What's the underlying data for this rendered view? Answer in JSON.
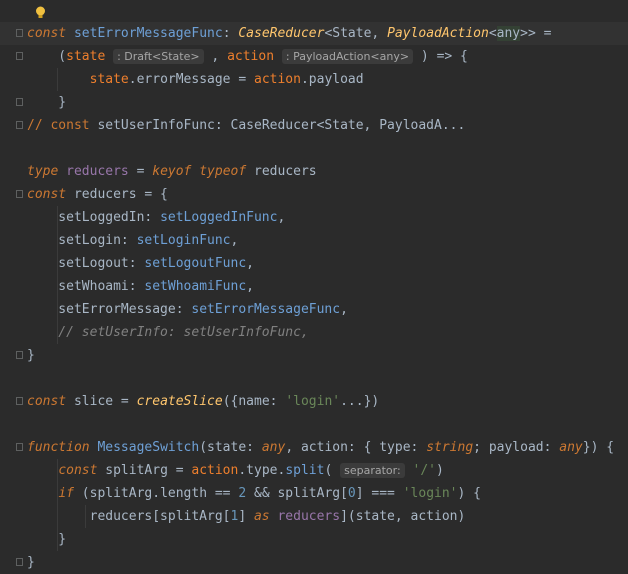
{
  "editor": {
    "lines": [
      {
        "kind": "code",
        "tokens": [
          {
            "t": "const ",
            "c": "kw"
          },
          {
            "t": "setErrorMessageFunc",
            "c": "fnlink"
          },
          {
            "t": ": ",
            "c": ""
          },
          {
            "t": "CaseReducer",
            "c": "ty"
          },
          {
            "t": "<State, ",
            "c": ""
          },
          {
            "t": "PayloadAction",
            "c": "ty"
          },
          {
            "t": "<",
            "c": ""
          },
          {
            "t": "any",
            "c": "hl"
          },
          {
            "t": ">> =",
            "c": ""
          }
        ]
      },
      {
        "kind": "code",
        "tokens": [
          {
            "t": "    (",
            "c": ""
          },
          {
            "t": "state",
            "c": "param"
          },
          {
            "t": " ",
            "c": ""
          },
          {
            "t": ": Draft<State>",
            "c": "hint"
          },
          {
            "t": " , ",
            "c": ""
          },
          {
            "t": "action",
            "c": "param"
          },
          {
            "t": " ",
            "c": ""
          },
          {
            "t": ": PayloadAction<any>",
            "c": "hint"
          },
          {
            "t": " ) => {",
            "c": ""
          }
        ]
      },
      {
        "kind": "code",
        "tokens": [
          {
            "t": "        ",
            "c": ""
          },
          {
            "t": "state",
            "c": "param"
          },
          {
            "t": ".errorMessage = ",
            "c": ""
          },
          {
            "t": "action",
            "c": "param"
          },
          {
            "t": ".payload",
            "c": ""
          }
        ]
      },
      {
        "kind": "code",
        "tokens": [
          {
            "t": "    }",
            "c": ""
          }
        ]
      },
      {
        "kind": "code",
        "tokens": [
          {
            "t": "// const ",
            "c": "cm2"
          },
          {
            "t": "setUserInfoFunc: CaseReducer<State, PayloadA...",
            "c": ""
          }
        ]
      },
      {
        "kind": "code",
        "tokens": []
      },
      {
        "kind": "code",
        "tokens": [
          {
            "t": "type ",
            "c": "kw"
          },
          {
            "t": "reducers",
            "c": "prop"
          },
          {
            "t": " = ",
            "c": ""
          },
          {
            "t": "keyof ",
            "c": "kw"
          },
          {
            "t": "typeof ",
            "c": "kw"
          },
          {
            "t": "reducers",
            "c": ""
          }
        ]
      },
      {
        "kind": "code",
        "tokens": [
          {
            "t": "const ",
            "c": "kw"
          },
          {
            "t": "reducers = {",
            "c": ""
          }
        ]
      },
      {
        "kind": "code",
        "tokens": [
          {
            "t": "    setLoggedIn: ",
            "c": ""
          },
          {
            "t": "setLoggedInFunc",
            "c": "fnlink"
          },
          {
            "t": ",",
            "c": ""
          }
        ]
      },
      {
        "kind": "code",
        "tokens": [
          {
            "t": "    setLogin: ",
            "c": ""
          },
          {
            "t": "setLoginFunc",
            "c": "fnlink"
          },
          {
            "t": ",",
            "c": ""
          }
        ]
      },
      {
        "kind": "code",
        "tokens": [
          {
            "t": "    setLogout: ",
            "c": ""
          },
          {
            "t": "setLogoutFunc",
            "c": "fnlink"
          },
          {
            "t": ",",
            "c": ""
          }
        ]
      },
      {
        "kind": "code",
        "tokens": [
          {
            "t": "    setWhoami: ",
            "c": ""
          },
          {
            "t": "setWhoamiFunc",
            "c": "fnlink"
          },
          {
            "t": ",",
            "c": ""
          }
        ]
      },
      {
        "kind": "code",
        "tokens": [
          {
            "t": "    setErrorMessage: ",
            "c": ""
          },
          {
            "t": "setErrorMessageFunc",
            "c": "fnlink"
          },
          {
            "t": ",",
            "c": ""
          }
        ]
      },
      {
        "kind": "code",
        "tokens": [
          {
            "t": "    // setUserInfo: setUserInfoFunc,",
            "c": "cm"
          }
        ]
      },
      {
        "kind": "code",
        "tokens": [
          {
            "t": "}",
            "c": ""
          }
        ]
      },
      {
        "kind": "code",
        "tokens": []
      },
      {
        "kind": "code",
        "tokens": [
          {
            "t": "const ",
            "c": "kw"
          },
          {
            "t": "slice = ",
            "c": ""
          },
          {
            "t": "createSlice",
            "c": "fn"
          },
          {
            "t": "({name: ",
            "c": ""
          },
          {
            "t": "'login'",
            "c": "str"
          },
          {
            "t": "...})",
            "c": ""
          }
        ]
      },
      {
        "kind": "code",
        "tokens": []
      },
      {
        "kind": "code",
        "tokens": [
          {
            "t": "function ",
            "c": "kw"
          },
          {
            "t": "MessageSwitch",
            "c": "fnlink"
          },
          {
            "t": "(state: ",
            "c": ""
          },
          {
            "t": "any",
            "c": "kw"
          },
          {
            "t": ", action: { type: ",
            "c": ""
          },
          {
            "t": "string",
            "c": "kw"
          },
          {
            "t": "; payload: ",
            "c": ""
          },
          {
            "t": "any",
            "c": "kw"
          },
          {
            "t": "}) {",
            "c": ""
          }
        ]
      },
      {
        "kind": "code",
        "tokens": [
          {
            "t": "    ",
            "c": ""
          },
          {
            "t": "const ",
            "c": "kw"
          },
          {
            "t": "splitArg = ",
            "c": ""
          },
          {
            "t": "action",
            "c": "param"
          },
          {
            "t": ".type.",
            "c": ""
          },
          {
            "t": "split",
            "c": "fnlink"
          },
          {
            "t": "( ",
            "c": ""
          },
          {
            "t": "separator:",
            "c": "hint"
          },
          {
            "t": " ",
            "c": ""
          },
          {
            "t": "'/'",
            "c": "str"
          },
          {
            "t": ")",
            "c": ""
          }
        ]
      },
      {
        "kind": "code",
        "tokens": [
          {
            "t": "    ",
            "c": ""
          },
          {
            "t": "if ",
            "c": "kw"
          },
          {
            "t": "(splitArg.length == ",
            "c": ""
          },
          {
            "t": "2",
            "c": "num"
          },
          {
            "t": " && splitArg[",
            "c": ""
          },
          {
            "t": "0",
            "c": "num"
          },
          {
            "t": "] === ",
            "c": ""
          },
          {
            "t": "'login'",
            "c": "str"
          },
          {
            "t": ") {",
            "c": ""
          }
        ]
      },
      {
        "kind": "code",
        "tokens": [
          {
            "t": "        reducers[splitArg[",
            "c": ""
          },
          {
            "t": "1",
            "c": "num"
          },
          {
            "t": "] ",
            "c": ""
          },
          {
            "t": "as ",
            "c": "kw"
          },
          {
            "t": "reducers",
            "c": "prop"
          },
          {
            "t": "](state, action)",
            "c": ""
          }
        ]
      },
      {
        "kind": "code",
        "tokens": [
          {
            "t": "    }",
            "c": ""
          }
        ]
      },
      {
        "kind": "code",
        "tokens": [
          {
            "t": "}",
            "c": ""
          }
        ]
      }
    ]
  }
}
